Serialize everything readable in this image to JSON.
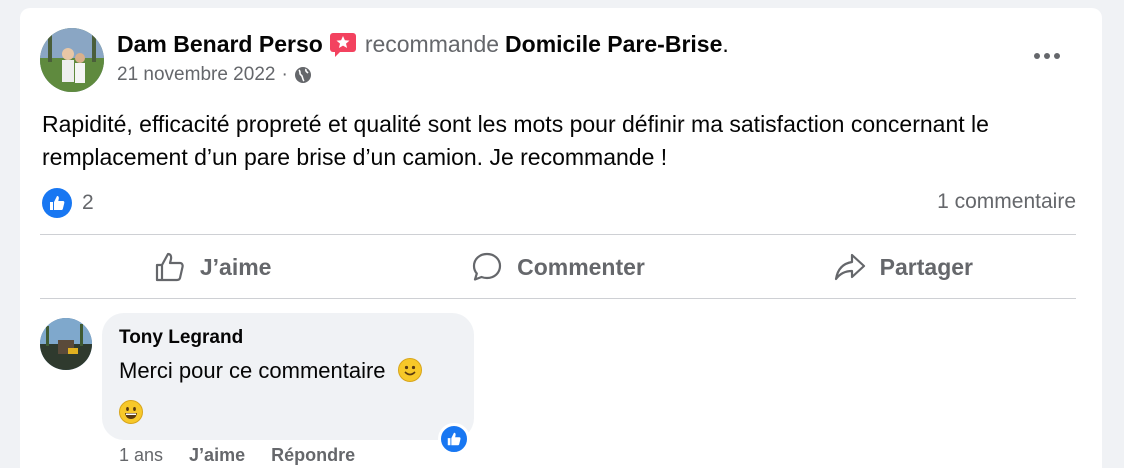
{
  "post": {
    "author": "Dam Benard Perso",
    "verb": "recommande",
    "page": "Domicile Pare-Brise",
    "period": ".",
    "date": "21 novembre 2022",
    "separator": "·",
    "privacy_icon": "globe-icon",
    "recommend_icon": "recommend-star-icon",
    "text": "Rapidité, efficacité propreté et qualité sont les mots pour définir ma satisfaction concernant le remplacement d’un pare brise d’un camion. Je recommande !",
    "reaction_count": "2",
    "comment_count": "1 commentaire"
  },
  "actions": {
    "like": "J’aime",
    "comment": "Commenter",
    "share": "Partager"
  },
  "comment": {
    "author": "Tony Legrand",
    "text": "Merci pour ce commentaire",
    "emoji_icon": "smiley-icon",
    "emoji2_icon": "grinning-icon",
    "time": "1 ans",
    "like": "J’aime",
    "reply": "Répondre"
  },
  "colors": {
    "accent": "#1877f2",
    "secondary_text": "#65676b",
    "recommend_badge": "#f3425f"
  }
}
